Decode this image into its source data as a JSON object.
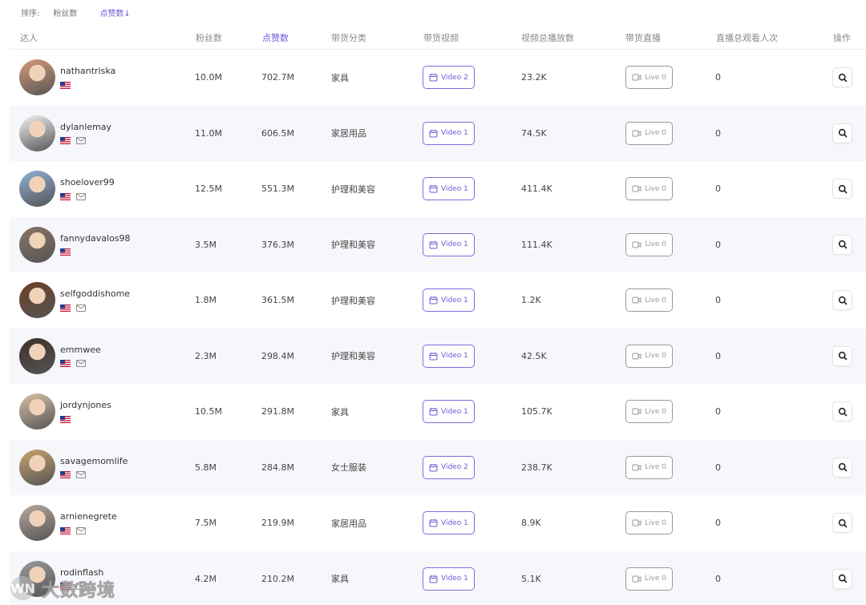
{
  "sort": {
    "label": "排序:",
    "options": [
      "粉丝数",
      "点赞数↓"
    ],
    "active_index": 1
  },
  "columns": [
    "达人",
    "粉丝数",
    "点赞数",
    "带货分类",
    "带货视频",
    "视频总播放数",
    "带货直播",
    "直播总观看人次",
    "操作"
  ],
  "rows": [
    {
      "name": "nathantriska",
      "followers": "10.0M",
      "likes": "702.7M",
      "category": "家具",
      "video": "Video 2",
      "plays": "23.2K",
      "live": "Live 0",
      "viewers": "0",
      "has_mail": false,
      "avatar_color": "#d89a7a"
    },
    {
      "name": "dylanlemay",
      "followers": "11.0M",
      "likes": "606.5M",
      "category": "家居用品",
      "video": "Video 1",
      "plays": "74.5K",
      "live": "Live 0",
      "viewers": "0",
      "has_mail": true,
      "avatar_color": "#f2f2f2"
    },
    {
      "name": "shoelover99",
      "followers": "12.5M",
      "likes": "551.3M",
      "category": "护理和美容",
      "video": "Video 1",
      "plays": "411.4K",
      "live": "Live 0",
      "viewers": "0",
      "has_mail": true,
      "avatar_color": "#8fb0d8"
    },
    {
      "name": "fannydavalos98",
      "followers": "3.5M",
      "likes": "376.3M",
      "category": "护理和美容",
      "video": "Video 1",
      "plays": "111.4K",
      "live": "Live 0",
      "viewers": "0",
      "has_mail": false,
      "avatar_color": "#8a7566"
    },
    {
      "name": "selfgoddishome",
      "followers": "1.8M",
      "likes": "361.5M",
      "category": "护理和美容",
      "video": "Video 1",
      "plays": "1.2K",
      "live": "Live 0",
      "viewers": "0",
      "has_mail": true,
      "avatar_color": "#6b3f24"
    },
    {
      "name": "emmwee",
      "followers": "2.3M",
      "likes": "298.4M",
      "category": "护理和美容",
      "video": "Video 1",
      "plays": "42.5K",
      "live": "Live 0",
      "viewers": "0",
      "has_mail": true,
      "avatar_color": "#3d3028"
    },
    {
      "name": "jordynjones",
      "followers": "10.5M",
      "likes": "291.8M",
      "category": "家具",
      "video": "Video 1",
      "plays": "105.7K",
      "live": "Live 0",
      "viewers": "0",
      "has_mail": false,
      "avatar_color": "#d8c2a6"
    },
    {
      "name": "savagemomlife",
      "followers": "5.8M",
      "likes": "284.8M",
      "category": "女士服装",
      "video": "Video 2",
      "plays": "238.7K",
      "live": "Live 0",
      "viewers": "0",
      "has_mail": true,
      "avatar_color": "#c9a26e"
    },
    {
      "name": "arnienegrete",
      "followers": "7.5M",
      "likes": "219.9M",
      "category": "家居用品",
      "video": "Video 1",
      "plays": "8.9K",
      "live": "Live 0",
      "viewers": "0",
      "has_mail": true,
      "avatar_color": "#b8a8a0"
    },
    {
      "name": "rodinflash",
      "followers": "4.2M",
      "likes": "210.2M",
      "category": "家具",
      "video": "Video 1",
      "plays": "5.1K",
      "live": "Live 0",
      "viewers": "0",
      "has_mail": true,
      "avatar_color": "#9a9a9a"
    }
  ],
  "watermark": {
    "text": "大数跨境",
    "avatar_text": "WN"
  },
  "colors": {
    "accent": "#6a5cd6",
    "row_alt": "#f6f7fb",
    "border": "#ececec"
  }
}
